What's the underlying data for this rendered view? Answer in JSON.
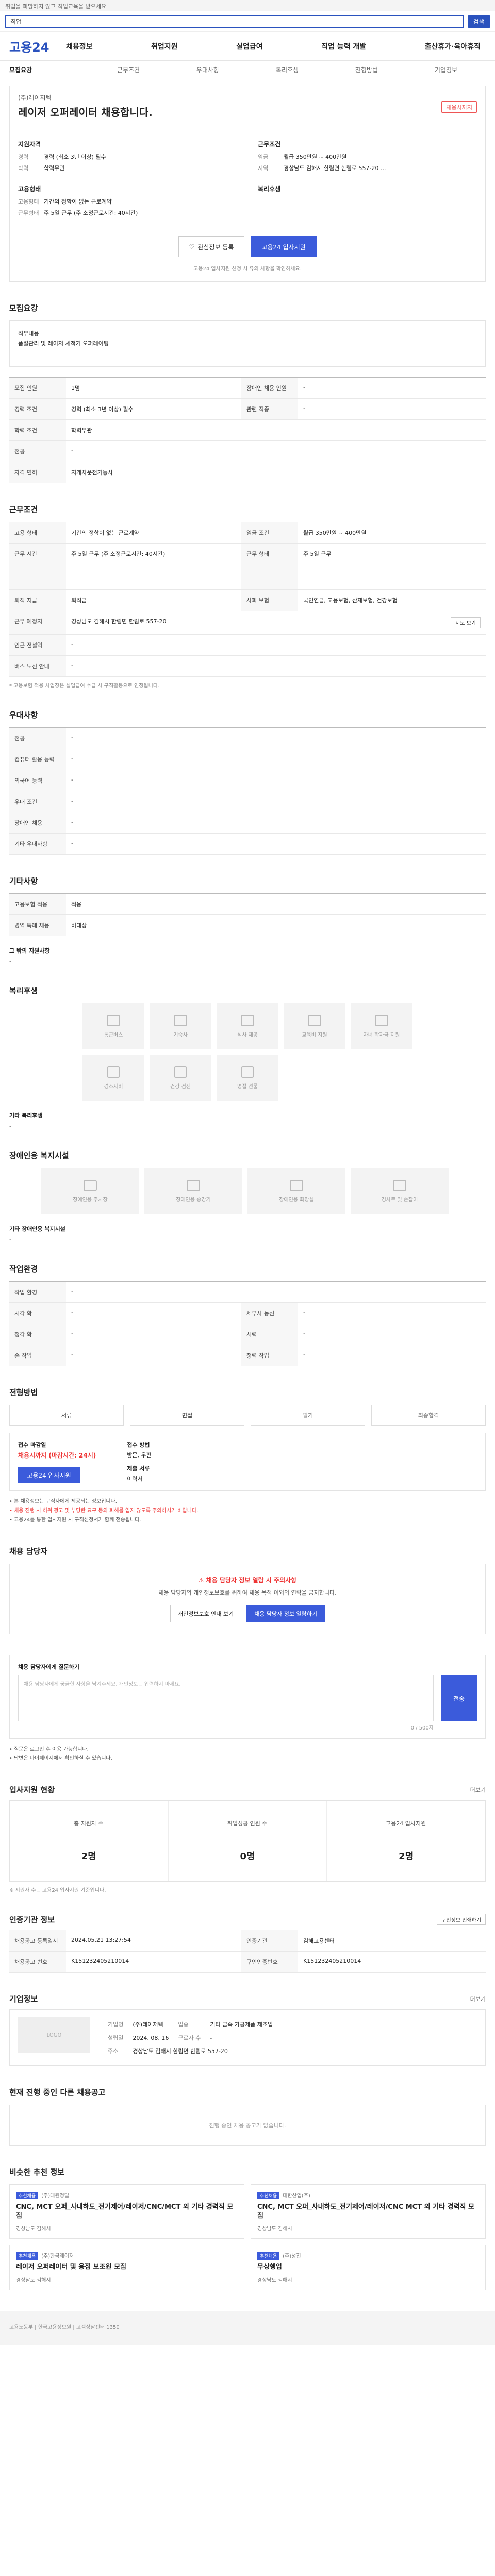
{
  "topbar": {
    "text": "취업을 희망하지 않고 직업교육을 받으세요"
  },
  "search": {
    "value": "직업",
    "button": "검색"
  },
  "logo": "고용24",
  "gnb": [
    "채용정보",
    "취업지원",
    "실업급여",
    "직업 능력 개발",
    "출산휴가·육아휴직"
  ],
  "tabs": [
    "모집요강",
    "근무조건",
    "우대사항",
    "복리후생",
    "전형방법",
    "기업정보"
  ],
  "header": {
    "corp": "(주)레이저텍",
    "title": "레이저 오퍼레이터 채용합니다.",
    "badge": "채용시까지",
    "col1_title": "지원자격",
    "col1": [
      [
        "경력",
        "경력 (최소 3년 이상) 필수"
      ],
      [
        "학력",
        "학력무관"
      ]
    ],
    "col2_title": "근무조건",
    "col2": [
      [
        "임금",
        "월급 350만원 ~ 400만원"
      ],
      [
        "지역",
        "경상남도 김해시 한림면 한림로 557-20 ..."
      ]
    ],
    "col3_title": "고용형태",
    "col3": [
      [
        "고용형태",
        "기간의 정함이 없는 근로계약"
      ],
      [
        "근무형태",
        "주 5일 근무 (주 소정근로시간: 40시간)"
      ]
    ],
    "col4_title": "복리후생",
    "btn_scrap": "관심정보 등록",
    "btn_apply": "고용24 입사지원",
    "note": "고용24 입사지원 신청 시 유의 사항을 확인하세요."
  },
  "recruit": {
    "heading": "모집요강",
    "box": "직무내용\n품질관리 및 레이저 세척기 오퍼레이팅",
    "rows": [
      [
        [
          "모집 인원",
          "1명"
        ],
        [
          "장애인 채용 인원",
          "-"
        ]
      ],
      [
        [
          "경력 조건",
          "경력 (최소 3년 이상) 필수"
        ],
        [
          "관련 직종",
          "-"
        ]
      ],
      [
        [
          "학력 조건",
          "학력무관"
        ],
        [
          "",
          ""
        ]
      ],
      [
        [
          "전공",
          "-"
        ],
        [
          "",
          ""
        ]
      ],
      [
        [
          "자격 면허",
          "지게차운전기능사"
        ],
        [
          "",
          ""
        ]
      ]
    ]
  },
  "conditions": {
    "heading": "근무조건",
    "rows": [
      [
        [
          "고용 형태",
          "기간의 정함이 없는 근로계약"
        ],
        [
          "임금 조건",
          "월급 350만원 ~ 400만원"
        ]
      ],
      [
        [
          "근무 시간",
          "주 5일 근무 (주 소정근로시간: 40시간)"
        ],
        [
          "근무 형태",
          "주 5일 근무"
        ]
      ],
      [
        [
          "퇴직 지급",
          "퇴직금"
        ],
        [
          "사회 보험",
          "국민연금, 고용보험, 산재보험, 건강보험"
        ]
      ],
      [
        [
          "근무 예정지",
          "경상남도 김해시 한림면 한림로 557-20"
        ],
        [
          "",
          ""
        ]
      ],
      [
        [
          "인근 전철역",
          "-"
        ],
        [
          "",
          ""
        ]
      ],
      [
        [
          "버스 노선 안내",
          "-"
        ],
        [
          "",
          ""
        ]
      ]
    ],
    "map_button": "지도 보기",
    "note": "* 고용보험 적용 사업장은 실업급여 수급 시 구직활동으로 인정됩니다."
  },
  "preference": {
    "heading": "우대사항",
    "rows": [
      [
        "전공",
        "-"
      ],
      [
        "컴퓨터 활용 능력",
        "-"
      ],
      [
        "외국어 능력",
        "-"
      ],
      [
        "우대 조건",
        "-"
      ],
      [
        "장애인 채용",
        "-"
      ],
      [
        "기타 우대사항",
        "-"
      ]
    ]
  },
  "etc": {
    "heading": "기타사항",
    "rows": [
      [
        "고용보험 적용",
        "적용"
      ],
      [
        "병역 특례 채용",
        "비대상"
      ]
    ],
    "sub": "그 밖의 지원사항",
    "sub_value": "-"
  },
  "benefits": {
    "heading": "복리후생",
    "icons": [
      "통근버스",
      "기숙사",
      "식사 제공",
      "교육비 지원",
      "자녀 학자금 지원",
      "경조사비",
      "건강 검진",
      "명절 선물"
    ],
    "sub": "기타 복리후생",
    "sub_value": "-"
  },
  "disability": {
    "heading": "장애인용 복지시설",
    "icons": [
      "장애인용 주차장",
      "장애인용 승강기",
      "장애인용 화장실",
      "경사로 및 손잡이"
    ],
    "sub": "기타 장애인용 복지시설",
    "sub_value": "-"
  },
  "workenv": {
    "heading": "작업환경",
    "rows": [
      [
        [
          "작업 환경",
          "-"
        ],
        [
          "",
          ""
        ]
      ],
      [
        [
          "시각 확",
          "-"
        ],
        [
          "세부사 동선",
          "-"
        ]
      ],
      [
        [
          "청각 확",
          "-"
        ],
        [
          "시력",
          "-"
        ]
      ],
      [
        [
          "손 작업",
          "-"
        ],
        [
          "청력 작업",
          "-"
        ]
      ]
    ]
  },
  "selection": {
    "heading": "전형방법",
    "steps": [
      "서류",
      "면접",
      "필기",
      "최종합격"
    ],
    "apply_title": "접수 마감일",
    "deadline": "채용시까지 (마감시간: 24시)",
    "method_title": "접수 방법",
    "method": "방문, 우편",
    "apply_btn": "고용24 입사지원",
    "docs_title": "제출 서류",
    "docs": "이력서",
    "bullets": [
      "본 채용정보는 구직자에게 제공되는 정보입니다.",
      "채용 진행 시 허위 광고 및 부당한 요구 등의 피해를 입지 않도록 주의하시기 바랍니다.",
      "고용24를 통한 입사지원 시 구직신청서가 함께 전송됩니다."
    ]
  },
  "contact": {
    "heading": "채용 담당자",
    "warn": "채용 담당자 정보 열람 시 주의사항",
    "text": "채용 담당자의 개인정보보호를 위하여 채용 목적 이외의 연락을 금지합니다.",
    "btn1": "개인정보보호 안내 보기",
    "btn2": "채용 담당자 정보 열람하기"
  },
  "qa": {
    "heading": "채용 담당자에게 질문하기",
    "placeholder": "채용 담당자에게 궁금한 사항을 남겨주세요. 개인정보는 입력하지 마세요.",
    "send": "전송",
    "count": "0 / 500자",
    "notes": [
      "질문은 로그인 후 이용 가능합니다.",
      "답변은 마이페이지에서 확인하실 수 있습니다."
    ]
  },
  "applicants": {
    "heading": "입사지원 현황",
    "more": "더보기",
    "stats": [
      [
        "총 지원자 수",
        "2명"
      ],
      [
        "취업성공 인원 수",
        "0명"
      ],
      [
        "고용24 입사지원",
        "2명"
      ]
    ],
    "note": "※ 지원자 수는 고용24 입사지원 기준입니다."
  },
  "cert": {
    "heading": "인증기관 정보",
    "print": "구인정보 인쇄하기",
    "rows": [
      [
        [
          "채용공고 등록일시",
          "2024.05.21 13:27:54"
        ],
        [
          "인증기관",
          "김해고용센터"
        ]
      ],
      [
        [
          "채용공고 번호",
          "K151232405210014"
        ],
        [
          "구인인증번호",
          "K151232405210014"
        ]
      ]
    ]
  },
  "company": {
    "heading": "기업정보",
    "more": "더보기",
    "logo": "LOGO",
    "rows": [
      [
        [
          "기업명",
          "(주)레이저텍"
        ],
        [
          "업종",
          "기타 금속 가공제품 제조업"
        ]
      ],
      [
        [
          "설립일",
          "2024. 08. 16"
        ],
        [
          "근로자 수",
          "-"
        ]
      ],
      [
        [
          "주소",
          "경상남도 김해시 한림면 한림로 557-20"
        ],
        [
          "",
          ""
        ]
      ]
    ]
  },
  "other": {
    "heading": "현재 진행 중인 다른 채용공고",
    "empty": "진행 중인 채용 공고가 없습니다."
  },
  "similar": {
    "heading": "비슷한 추천 정보",
    "cards": [
      {
        "tag": "추천채용",
        "company": "(주)대원정밀",
        "title": "CNC, MCT 오퍼_사내하도_전기제어/레이저/CNC/MCT 외 기타 경력직 모집",
        "loc": "경상남도 김해시"
      },
      {
        "tag": "추천채용",
        "company": "대한산업(주)",
        "title": "CNC, MCT 오퍼_사내하도_전기제어/레이저/CNC MCT 외 기타 경력직 모집",
        "loc": "경상남도 김해시"
      },
      {
        "tag": "추천채용",
        "company": "(주)한국레이저",
        "title": "레이저 오퍼레이터 및 용접 보조원 모집",
        "loc": "경상남도 김해시"
      },
      {
        "tag": "추천채용",
        "company": "(주)성진",
        "title": "무상행업",
        "loc": "경상남도 김해시"
      }
    ]
  },
  "footer": {
    "text": "고용노동부 | 한국고용정보원 | 고객상담센터 1350"
  }
}
